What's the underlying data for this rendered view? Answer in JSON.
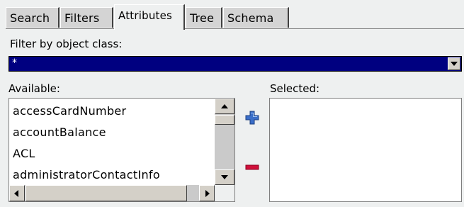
{
  "tabs": [
    {
      "label": "Search",
      "active": false
    },
    {
      "label": "Filters",
      "active": false
    },
    {
      "label": "Attributes",
      "active": true
    },
    {
      "label": "Tree",
      "active": false
    },
    {
      "label": "Schema",
      "active": false
    }
  ],
  "filter": {
    "label": "Filter by object class:",
    "selected_value": "*"
  },
  "available": {
    "label": "Available:",
    "items": [
      "accessCardNumber",
      "accountBalance",
      "ACL",
      "administratorContactInfo"
    ]
  },
  "selected": {
    "label": "Selected:",
    "items": []
  },
  "icons": {
    "add": "plus-icon",
    "remove": "minus-icon"
  },
  "colors": {
    "combo_selection": "#000080",
    "add_icon": "#3a6ec8",
    "remove_icon": "#d0103a"
  }
}
